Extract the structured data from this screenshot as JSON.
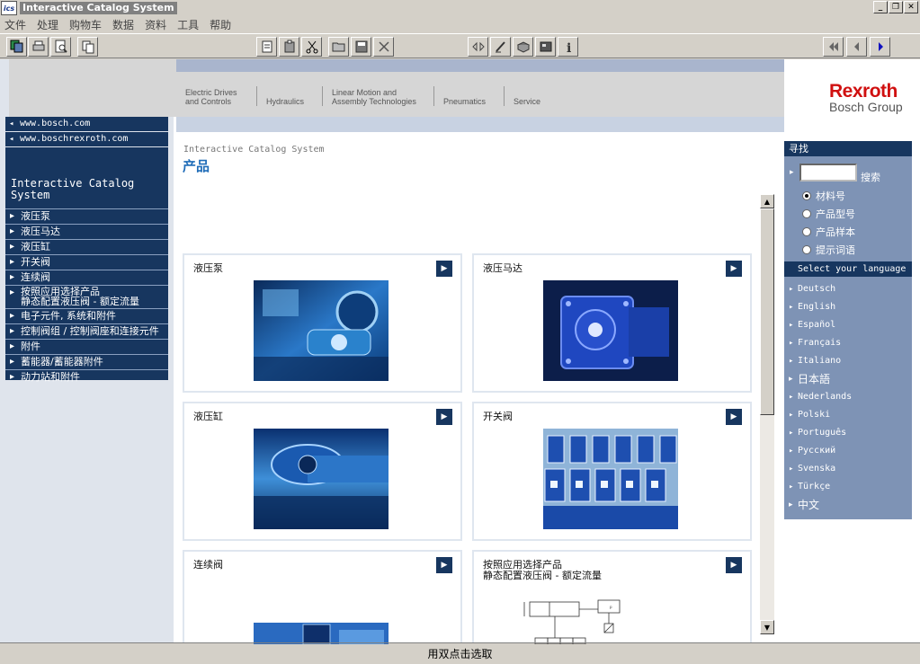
{
  "app": {
    "icon_text": "ics",
    "title": "Interactive Catalog System"
  },
  "menu": [
    "文件",
    "处理",
    "购物车",
    "数据",
    "资料",
    "工具",
    "帮助"
  ],
  "toolbar": {
    "icons": [
      "copy-pages-icon",
      "print-icon",
      "print-preview-icon",
      "copy-icon",
      "paste-list-icon",
      "clipboard-icon",
      "cut-icon",
      "open-folder-icon",
      "save-icon",
      "delete-icon",
      "compare-icon",
      "edit-icon",
      "book-icon",
      "database-icon",
      "info-icon",
      "first-page-icon",
      "previous-icon",
      "next-icon"
    ]
  },
  "header": {
    "nav": [
      {
        "label": "Electric Drives\nand Controls"
      },
      {
        "label": "Hydraulics"
      },
      {
        "label": "Linear Motion and\nAssembly Technologies"
      },
      {
        "label": "Pneumatics"
      },
      {
        "label": "Service"
      }
    ],
    "logo": {
      "brand": "Rexroth",
      "group": "Bosch Group"
    }
  },
  "left": {
    "links": [
      "www.bosch.com",
      "www.boschrexroth.com"
    ],
    "title": "Interactive Catalog System",
    "items": [
      "液压泵",
      "液压马达",
      "液压缸",
      "开关阀",
      "连续阀",
      "按照应用选择产品\n静态配置液压阀 - 额定流量",
      "电子元件, 系统和附件",
      "控制阀组 / 控制阀座和连接元件",
      "附件",
      "蓄能器/蓄能器附件",
      "动力站和附件"
    ]
  },
  "content": {
    "crumb": "Interactive Catalog System",
    "title": "产品",
    "cards": [
      {
        "label": "液压泵"
      },
      {
        "label": "液压马达"
      },
      {
        "label": "液压缸"
      },
      {
        "label": "开关阀"
      },
      {
        "label": "连续阀"
      },
      {
        "label": "按照应用选择产品\n静态配置液压阀 - 额定流量"
      }
    ]
  },
  "right": {
    "search_head": "寻找",
    "search_label": "搜索",
    "search_value": "",
    "options": [
      {
        "label": "材料号",
        "selected": true
      },
      {
        "label": "产品型号",
        "selected": false
      },
      {
        "label": "产品样本",
        "selected": false
      },
      {
        "label": "提示词语",
        "selected": false
      }
    ],
    "lang_head": "Select your language",
    "languages": [
      "Deutsch",
      "English",
      "Español",
      "Français",
      "Italiano",
      "日本語",
      "Nederlands",
      "Polski",
      "Português",
      "Русский",
      "Svenska",
      "Türkçe",
      "中文"
    ]
  },
  "status": "用双点击选取",
  "colors": {
    "navy": "#17365f",
    "accent_blue": "#1f6cb8",
    "rexroth_red": "#d01010",
    "panel_blue": "#7e93b5"
  }
}
